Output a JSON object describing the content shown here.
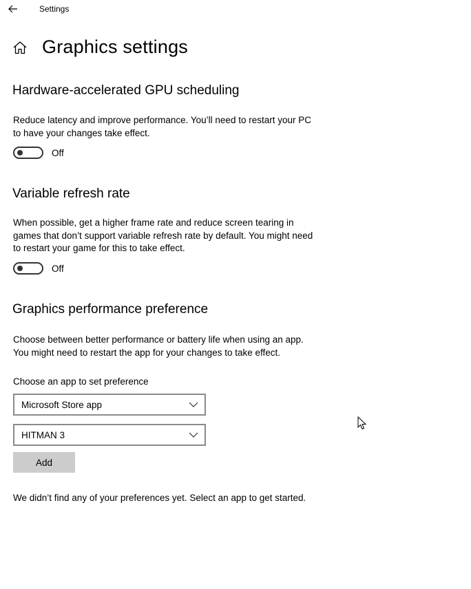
{
  "window": {
    "title": "Settings"
  },
  "page": {
    "title": "Graphics settings"
  },
  "gpu_scheduling": {
    "heading": "Hardware-accelerated GPU scheduling",
    "description": "Reduce latency and improve performance. You’ll need to restart your PC to have your changes take effect.",
    "toggle_state": "Off"
  },
  "vrr": {
    "heading": "Variable refresh rate",
    "description": "When possible, get a higher frame rate and reduce screen tearing in games that don’t support variable refresh rate by default. You might need to restart your game for this to take effect.",
    "toggle_state": "Off"
  },
  "performance": {
    "heading": "Graphics performance preference",
    "description": "Choose between better performance or battery life when using an app. You might need to restart the app for your changes to take effect.",
    "choose_label": "Choose an app to set preference",
    "app_type_selected": "Microsoft Store app",
    "app_selected": "HITMAN 3",
    "add_label": "Add",
    "empty_message": "We didn’t find any of your preferences yet. Select an app to get started."
  },
  "icons": {
    "back": "back-arrow-icon",
    "home": "home-icon",
    "dropdown": "chevron-down-icon",
    "cursor": "mouse-pointer-icon"
  },
  "colors": {
    "toggle_off": "#333333",
    "combo_border": "#8a8a8a",
    "button_bg": "#cccccc"
  }
}
